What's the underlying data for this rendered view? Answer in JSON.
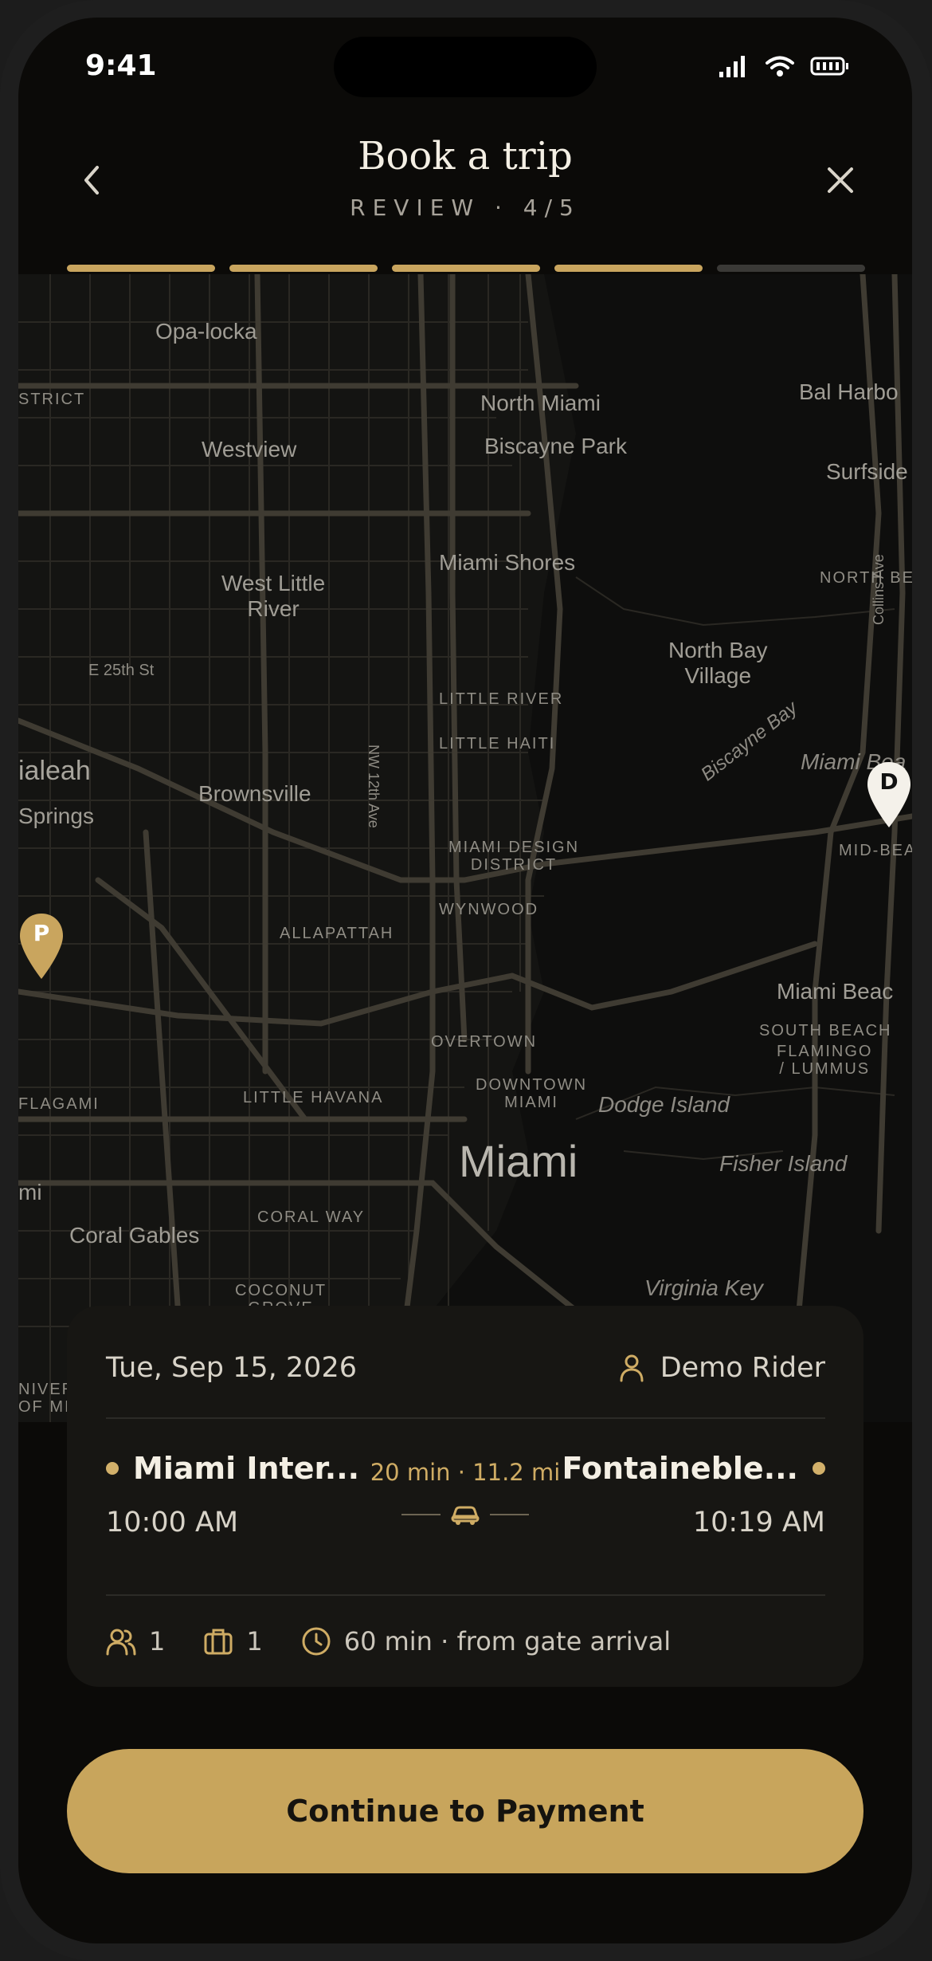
{
  "status": {
    "time": "9:41"
  },
  "header": {
    "title": "Book a trip",
    "subtitle": "REVIEW · 4/5",
    "progress": {
      "current_step": 4,
      "total_steps": 5
    }
  },
  "map": {
    "labels": {
      "opa_locka": "Opa-locka",
      "district": "STRICT",
      "westview": "Westview",
      "north_miami": "North Miami",
      "biscayne_park": "Biscayne Park",
      "bal_harbour": "Bal Harbo",
      "surfside": "Surfside",
      "west_little_river": "West Little\nRiver",
      "miami_shores": "Miami Shores",
      "north_be": "NORTH BE",
      "e25th": "E 25th St",
      "north_bay_village": "North Bay\nVillage",
      "collins_ave": "Collins Ave",
      "little_river": "LITTLE RIVER",
      "little_haiti": "LITTLE HAITI",
      "hialeah": "ialeah",
      "springs": "Springs",
      "brownsville": "Brownsville",
      "nw12th": "NW 12th Ave",
      "biscayne_bay": "Biscayne Bay",
      "miami_beach_top": "Miami Bea",
      "mid_beach": "MID-BEA",
      "miami_design_district": "MIAMI DESIGN\nDISTRICT",
      "wynwood": "WYNWOOD",
      "allapattah": "ALLAPATTAH",
      "miami_beach": "Miami Beac",
      "overtown": "OVERTOWN",
      "south_beach": "SOUTH BEACH",
      "flamingo": "FLAMINGO\n/ LUMMUS",
      "flagami": "FLAGAMI",
      "little_havana": "LITTLE HAVANA",
      "downtown_miami": "DOWNTOWN\nMIAMI",
      "dodge_island": "Dodge Island",
      "miami": "Miami",
      "fisher_island": "Fisher Island",
      "mi": "mi",
      "coral_way": "CORAL WAY",
      "coral_gables": "Coral Gables",
      "coconut_grove": "COCONUT\nGROVE",
      "virginia_key": "Virginia Key",
      "univ": "NIVER\nOF MI"
    },
    "pickup_pin": "P",
    "dropoff_pin": "D"
  },
  "trip": {
    "date": "Tue, Sep 15, 2026",
    "rider": "Demo Rider",
    "from": {
      "name": "Miami Inter...",
      "time": "10:00 AM"
    },
    "to": {
      "name": "Fontaineble...",
      "time": "10:19 AM"
    },
    "eta": "20 min · 11.2 mi",
    "passengers": "1",
    "bags": "1",
    "wait": "60 min · from gate arrival"
  },
  "cta": {
    "label": "Continue to Payment"
  },
  "colors": {
    "accent": "#c8a55c",
    "background": "#0b0a08",
    "card": "#171613"
  }
}
